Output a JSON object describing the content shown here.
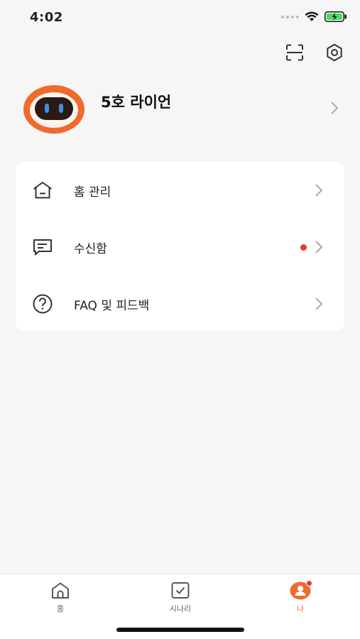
{
  "status_bar": {
    "time": "4:02",
    "icons": [
      "cellular-dots-icon",
      "wifi-icon",
      "battery-charging-icon"
    ],
    "battery_color": "#4cd964"
  },
  "top_actions": {
    "icons": [
      "scan-icon",
      "settings-icon"
    ]
  },
  "profile": {
    "name": "5호 라이언",
    "avatar_icon": "robot-avatar-icon",
    "accent_color": "#ee6b2c"
  },
  "menu": {
    "items": [
      {
        "icon": "home-icon",
        "label": "홈 관리",
        "has_badge": false
      },
      {
        "icon": "message-icon",
        "label": "수신함",
        "has_badge": true
      },
      {
        "icon": "question-icon",
        "label": "FAQ 및 피드백",
        "has_badge": false
      }
    ]
  },
  "tabs": [
    {
      "icon": "home-icon",
      "label": "홈",
      "active": false
    },
    {
      "icon": "checkbox-icon",
      "label": "시나리",
      "active": false
    },
    {
      "icon": "profile-icon",
      "label": "나",
      "active": true,
      "has_badge": true
    }
  ],
  "colors": {
    "accent": "#ee6b2c",
    "badge": "#e53935",
    "background": "#f6f6f6",
    "card": "#ffffff"
  }
}
